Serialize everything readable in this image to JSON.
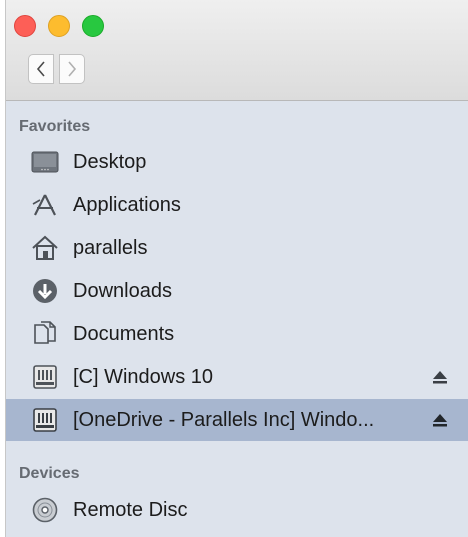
{
  "sidebar": {
    "favorites_title": "Favorites",
    "devices_title": "Devices",
    "favorites": [
      {
        "label": "Desktop",
        "icon": "desktop-icon"
      },
      {
        "label": "Applications",
        "icon": "applications-icon"
      },
      {
        "label": "parallels",
        "icon": "home-icon"
      },
      {
        "label": "Downloads",
        "icon": "downloads-icon"
      },
      {
        "label": "Documents",
        "icon": "documents-icon"
      },
      {
        "label": "[C] Windows 10",
        "icon": "drive-icon",
        "ejectable": true
      },
      {
        "label": "[OneDrive - Parallels Inc] Windo...",
        "icon": "drive-icon",
        "ejectable": true,
        "selected": true
      }
    ],
    "devices": [
      {
        "label": "Remote Disc",
        "icon": "disc-icon"
      }
    ]
  },
  "colors": {
    "sidebar_bg": "#dde3ec",
    "selected_bg": "#a7b6cf",
    "close": "#fd5f57",
    "minimize": "#fdbc2e",
    "zoom": "#28c840"
  }
}
